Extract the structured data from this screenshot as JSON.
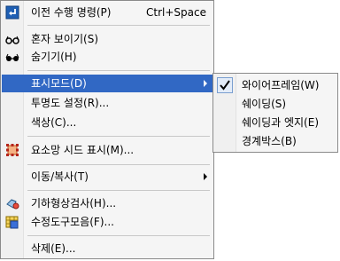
{
  "menu": {
    "items": [
      {
        "label": "이전 수행 명령(P)",
        "shortcut": "Ctrl+Space",
        "icon": "undo-arrow-icon"
      },
      {
        "label": "혼자 보이기(S)",
        "icon": "glasses-show-icon"
      },
      {
        "label": "숨기기(H)",
        "icon": "glasses-hide-icon"
      },
      {
        "label": "표시모드(D)",
        "icon": "",
        "submenu": true
      },
      {
        "label": "투명도 설정(R)...",
        "icon": ""
      },
      {
        "label": "색상(C)...",
        "icon": ""
      },
      {
        "label": "요소망 시드 표시(M)...",
        "icon": "mesh-seed-icon"
      },
      {
        "label": "이동/복사(T)",
        "icon": "",
        "submenu": true
      },
      {
        "label": "기하형상검사(H)...",
        "icon": "geometry-check-icon"
      },
      {
        "label": "수정도구모음(F)...",
        "icon": "repair-toolbox-icon"
      },
      {
        "label": "삭제(E)...",
        "icon": ""
      }
    ]
  },
  "submenu": {
    "items": [
      {
        "label": "와이어프레임(W)",
        "checked": true
      },
      {
        "label": "쉐이딩(S)",
        "checked": false
      },
      {
        "label": "쉐이딩과 엣지(E)",
        "checked": false
      },
      {
        "label": "경계박스(B)",
        "checked": false
      }
    ]
  },
  "colors": {
    "highlight": "#3168c4",
    "menu_bg": "#f5f5f5",
    "border": "#8a8a8a"
  }
}
